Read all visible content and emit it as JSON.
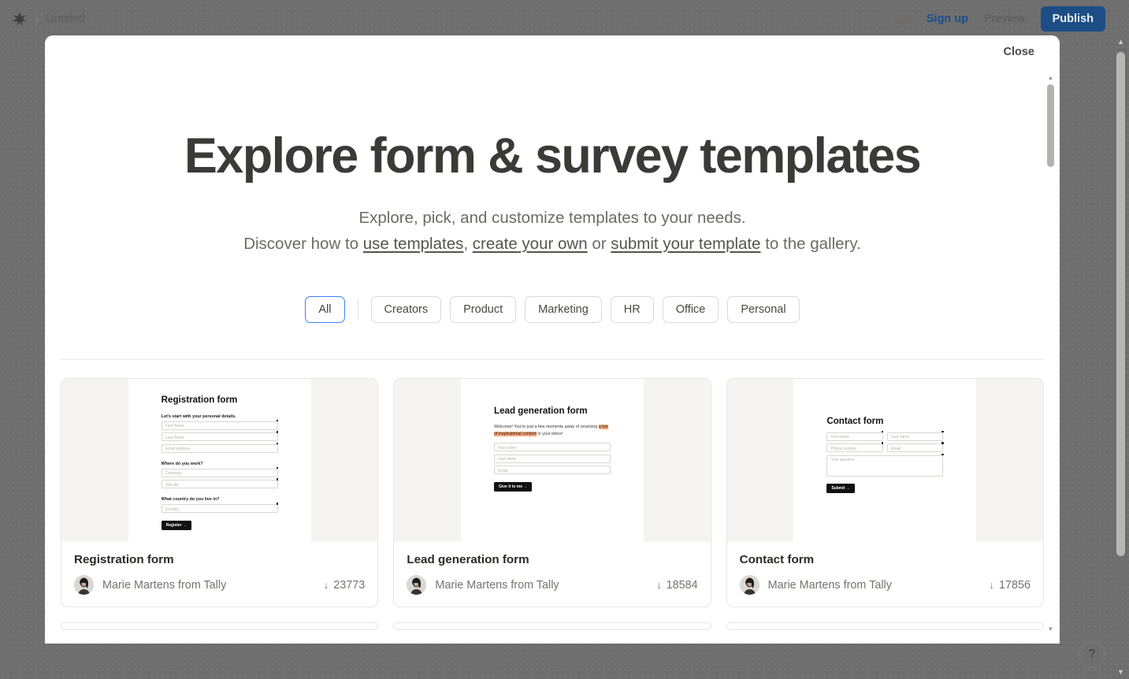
{
  "topbar": {
    "breadcrumb_separator": "›",
    "title": "Untitled",
    "gear_icon": "gear-icon",
    "signup_label": "Sign up",
    "preview_label": "Preview",
    "publish_label": "Publish",
    "publish_color": "#1c4e85",
    "signup_color": "#1a4f8a"
  },
  "modal": {
    "close_label": "Close",
    "heading": "Explore form & survey templates",
    "subtitle_line1": "Explore, pick, and customize templates to your needs.",
    "subtitle_line2_prefix": "Discover how to ",
    "link_use": "use templates",
    "sub_comma": ", ",
    "link_create": "create your own",
    "sub_or": " or ",
    "link_submit": "submit your template",
    "subtitle_line2_suffix": " to the gallery."
  },
  "filters": {
    "active": "All",
    "items": [
      {
        "label": "All",
        "active": true
      },
      {
        "label": "Creators",
        "active": false
      },
      {
        "label": "Product",
        "active": false
      },
      {
        "label": "Marketing",
        "active": false
      },
      {
        "label": "HR",
        "active": false
      },
      {
        "label": "Office",
        "active": false
      },
      {
        "label": "Personal",
        "active": false
      }
    ],
    "active_border_color": "#3b82f6"
  },
  "cards": [
    {
      "title": "Registration form",
      "author": "Marie Martens from Tally",
      "downloads": "23773",
      "download_icon": "↓",
      "preview": {
        "heading": "Registration form",
        "q1": "Let's start with your personal details.",
        "f1": "First Name",
        "f2": "Last Name",
        "f3": "Email address",
        "q2": "Where do you work?",
        "f4": "Company",
        "f5": "Job title",
        "q3": "What country do you live in?",
        "f6": "Country",
        "button": "Register →"
      }
    },
    {
      "title": "Lead generation form",
      "author": "Marie Martens from Tally",
      "downloads": "18584",
      "download_icon": "↓",
      "preview": {
        "heading": "Lead generation form",
        "blurb_pre": "Welcome! You're just a few moments away of receiving ",
        "blurb_hl": "a ton of inspirational content",
        "blurb_post": " in your inbox!",
        "f1": "First name",
        "f2": "Last name",
        "f3": "Email",
        "button": "Give it to me →",
        "highlight_color": "#f6a679"
      }
    },
    {
      "title": "Contact form",
      "author": "Marie Martens from Tally",
      "downloads": "17856",
      "download_icon": "↓",
      "preview": {
        "heading": "Contact form",
        "f1": "First name",
        "f2": "Last name",
        "f3": "Phone number",
        "f4": "Email",
        "f5": "Your question",
        "button": "Submit →"
      }
    }
  ],
  "help": {
    "label": "?"
  },
  "scroll": {
    "up_arrow": "▲",
    "down_arrow": "▼"
  }
}
